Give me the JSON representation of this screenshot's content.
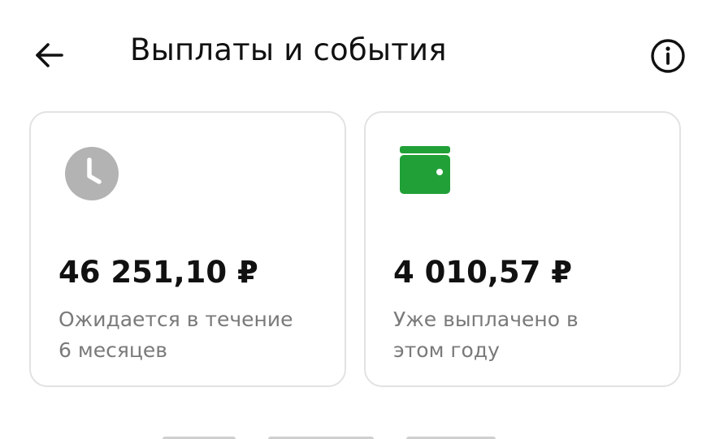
{
  "header": {
    "title": "Выплаты и события",
    "back_icon": "arrow-left-icon",
    "info_icon": "info-icon"
  },
  "cards": [
    {
      "amount": "46 251,10 ₽",
      "line1": "Ожидается в течение",
      "line2": "6 месяцев",
      "icon": "clock-icon",
      "icon_color": "#b3b3b3"
    },
    {
      "amount": "4 010,57 ₽",
      "line1": "Уже выплачено в",
      "line2": "этом году",
      "icon": "wallet-icon",
      "icon_color": "#21a038"
    }
  ]
}
